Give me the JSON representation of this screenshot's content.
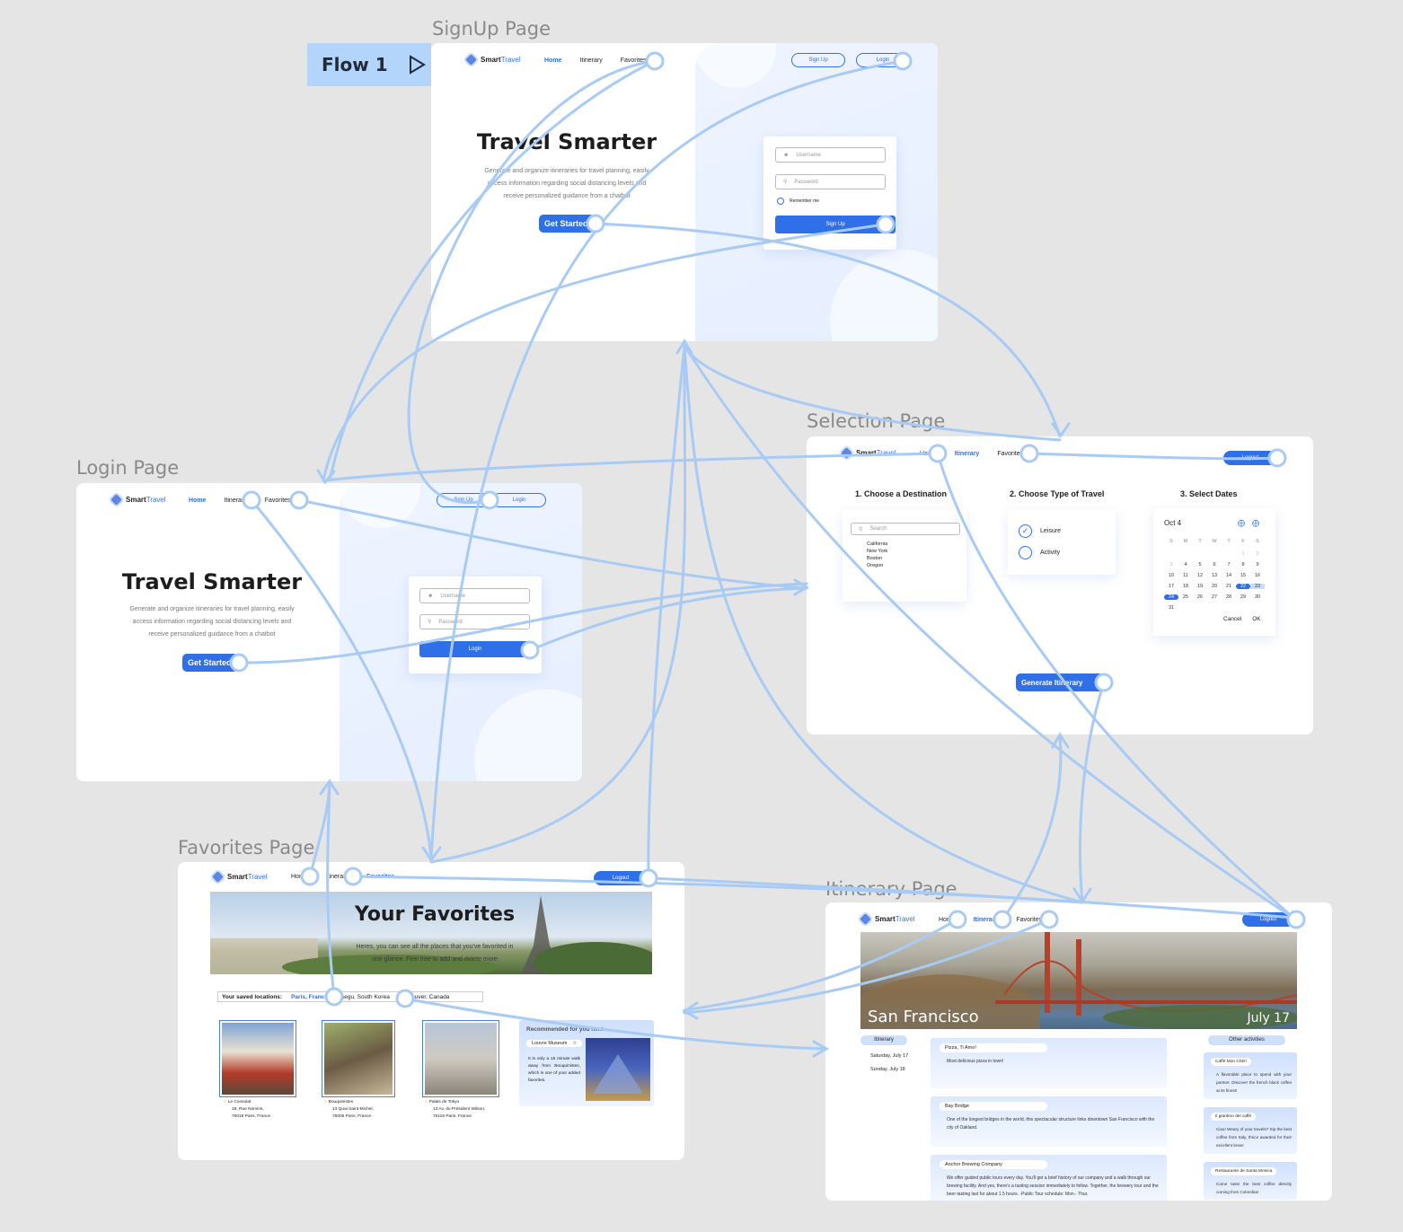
{
  "flow": {
    "label": "Flow 1"
  },
  "frames": {
    "signup": "SignUp Page",
    "login": "Login Page",
    "selection": "Selection Page",
    "favorites": "Favorites Page",
    "itinerary": "Itinerary Page"
  },
  "brand": {
    "smart": "Smart",
    "travel": "Travel"
  },
  "nav": {
    "home": "Home",
    "itinerary": "Itinerary",
    "favorites": "Favorites"
  },
  "auth": {
    "signup": "Sign Up",
    "login": "Login",
    "logout": "Logout"
  },
  "hero": {
    "title": "Travel Smarter",
    "subtitle_1": "Generate and organize itineraries for travel planning, easily",
    "subtitle_2": "access information regarding social distancing levels and",
    "subtitle_3": "receive personalized guidance from a chatbot",
    "cta": "Get Started"
  },
  "signup_form": {
    "username": "Username",
    "password": "Password",
    "remember": "Remember me",
    "submit": "Sign Up"
  },
  "login_form": {
    "username": "Username",
    "password": "Password",
    "submit": "Login"
  },
  "selection": {
    "step1": "1. Choose a Destination",
    "step2": "2. Choose Type of Travel",
    "step3": "3. Select Dates",
    "search_placeholder": "Search",
    "destinations": [
      "California",
      "New York",
      "Boston",
      "Oregon"
    ],
    "types": [
      "Leisure",
      "Activity"
    ],
    "calendar_month": "Oct 4",
    "weekdays": [
      "S",
      "M",
      "T",
      "W",
      "T",
      "F",
      "S"
    ],
    "days": [
      "",
      "",
      "",
      "",
      "",
      "1",
      "2",
      "3",
      "4",
      "5",
      "6",
      "7",
      "8",
      "9",
      "10",
      "11",
      "12",
      "13",
      "14",
      "15",
      "16",
      "17",
      "18",
      "19",
      "20",
      "21",
      "22",
      "23",
      "24",
      "25",
      "26",
      "27",
      "28",
      "29",
      "30",
      "31"
    ],
    "cancel": "Cancel",
    "ok": "OK",
    "generate": "Generate Itinerary"
  },
  "favorites": {
    "title": "Your Favorites",
    "subtitle_1": "Heres, you can see all the places that you've favorited in",
    "subtitle_2": "one glance. Feel free to add and delete more",
    "saved_label": "Your saved locations:",
    "saved": [
      "Paris, France",
      "Daegu, South Korea",
      "Vancouver, Canada"
    ],
    "cards": [
      {
        "name": "Le Consulat",
        "addr1": "18, Rue Norvins,",
        "addr2": "75018 Paris, France"
      },
      {
        "name": "Bouquinistes",
        "addr1": "13 Quai Saint-Michel,",
        "addr2": "75005 Paris, France"
      },
      {
        "name": "Palais de Tokyo",
        "addr1": "13 Av. du Président Wilson,",
        "addr2": "75116 Paris, France"
      }
    ],
    "recommended_title": "Recommended for you next...",
    "recommended_name": "Louvre Museum",
    "recommended_desc": "It is only a 15 minute walk away from Bouquinistes, which is one of your added favorites."
  },
  "itinerary": {
    "city": "San Francisco",
    "date": "July 17",
    "tab": "Itinerary",
    "days": [
      "Saturday, July 17",
      "Sunday, July 18"
    ],
    "items": [
      {
        "name": "Pizza, Ti Amo!",
        "desc": "Most delicious pizza in town!"
      },
      {
        "name": "Bay Bridge",
        "desc": "One of the longest bridges in the world, this spectacular structure links downtown San Francisco with the city of Oakland."
      },
      {
        "name": "Anchor Brewing Company",
        "desc": "We offer guided public tours every day. You'll get a brief history of our company and a walk through our brewing facility. And yes, there's a tasting session immediately to follow. Together, the brewery tour and the beer tasting last for about 1.5 hours. -Public Tour schedule: Mon.- Thur."
      }
    ],
    "other_title": "Other activities",
    "other": [
      {
        "name": "Caffè Mon Chéri",
        "desc": "A flavorable place to spend with your partner. Discover the french black coffee at its finest!"
      },
      {
        "name": "Il giardino del caffè",
        "desc": "Ciao! Weary of your travels? Sip the best coffee from Italy, thrice awarded for their excellent brew!"
      },
      {
        "name": "Restaurante de Santa Monica",
        "desc": "Come taste the best coffee directly coming from Colombia!"
      }
    ]
  },
  "colors": {
    "accent": "#2f6fe8",
    "wire": "#a8cbf5",
    "canvas": "#e5e5e5"
  }
}
